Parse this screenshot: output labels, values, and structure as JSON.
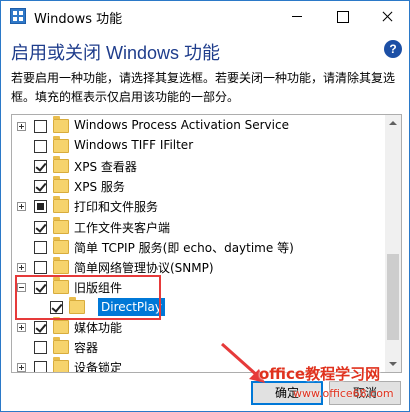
{
  "window": {
    "title": "Windows 功能"
  },
  "header": {
    "heading": "启用或关闭 Windows 功能",
    "help_icon": "question-circle-icon",
    "description": "若要启用一种功能，请选择其复选框。若要关闭一种功能，请清除其复选框。填充的框表示仅启用该功能的一部分。"
  },
  "features": [
    {
      "label": "Windows Process Activation Service",
      "expander": "plus",
      "check": "unchecked",
      "indent": 0
    },
    {
      "label": "Windows TIFF IFilter",
      "expander": "none",
      "check": "unchecked",
      "indent": 0
    },
    {
      "label": "XPS 查看器",
      "expander": "none",
      "check": "checked",
      "indent": 0
    },
    {
      "label": "XPS 服务",
      "expander": "none",
      "check": "checked",
      "indent": 0
    },
    {
      "label": "打印和文件服务",
      "expander": "plus",
      "check": "partial",
      "indent": 0
    },
    {
      "label": "工作文件夹客户端",
      "expander": "none",
      "check": "checked",
      "indent": 0
    },
    {
      "label": "简单 TCPIP 服务(即 echo、daytime 等)",
      "expander": "none",
      "check": "unchecked",
      "indent": 0
    },
    {
      "label": "简单网络管理协议(SNMP)",
      "expander": "plus",
      "check": "unchecked",
      "indent": 0
    },
    {
      "label": "旧版组件",
      "expander": "minus",
      "check": "checked",
      "indent": 0
    },
    {
      "label": "DirectPlay",
      "expander": "none",
      "check": "checked",
      "indent": 1,
      "selected": true
    },
    {
      "label": "媒体功能",
      "expander": "plus",
      "check": "checked",
      "indent": 0
    },
    {
      "label": "容器",
      "expander": "none",
      "check": "unchecked",
      "indent": 0
    },
    {
      "label": "设备锁定",
      "expander": "plus",
      "check": "unchecked",
      "indent": 0
    }
  ],
  "buttons": {
    "ok": "确定",
    "cancel": "取消"
  },
  "watermark": {
    "main": "office教程学习网",
    "url": "www.office68.com"
  },
  "colors": {
    "accent": "#0078d7",
    "heading": "#1f3d8c",
    "annotation": "#e63a3a",
    "folder": "#f6d36c"
  }
}
